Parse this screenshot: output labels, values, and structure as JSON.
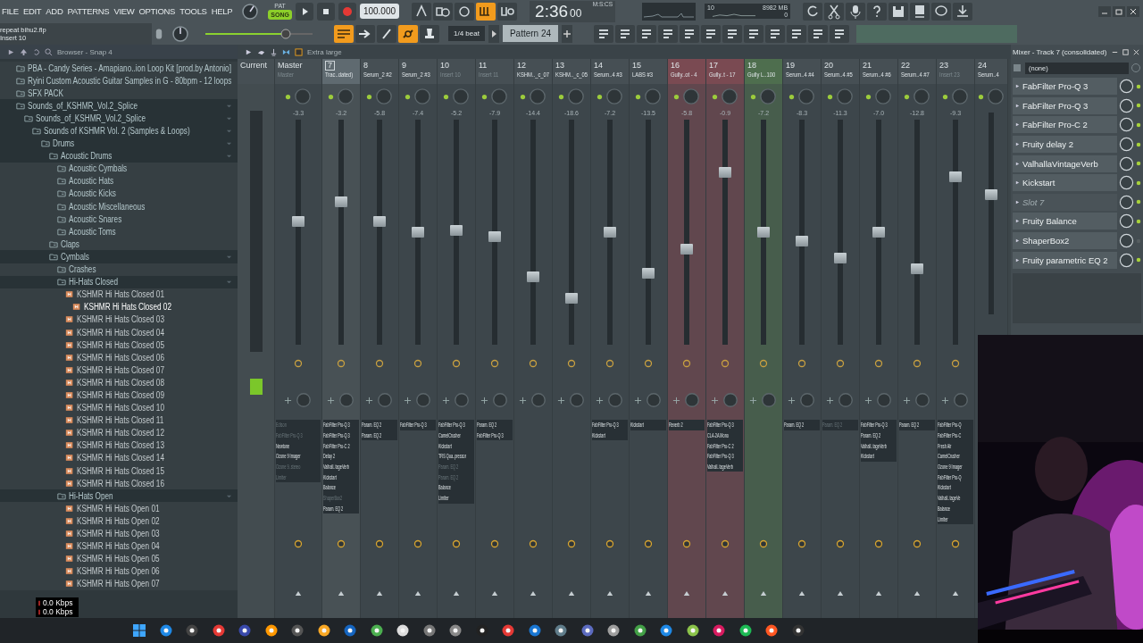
{
  "menu": [
    "FILE",
    "EDIT",
    "ADD",
    "PATTERNS",
    "VIEW",
    "OPTIONS",
    "TOOLS",
    "HELP"
  ],
  "transport": {
    "pat_label": "PAT",
    "mode_label": "SONG",
    "song_mode": true,
    "tempo": "100.000",
    "time": "2:36",
    "time_cs": "00",
    "time_unit": "M:S:CS",
    "cpu": "10",
    "memory": "8982 MB",
    "polyphony": "0"
  },
  "hint": {
    "file": "repeat bihu2.flp",
    "target": "Insert 10"
  },
  "snap": "1/4 beat",
  "pattern": "Pattern 24",
  "browser": {
    "title": "Browser - Snap 4",
    "tree": [
      {
        "kind": "folder",
        "name": "PBA - Candy Series - Amapiano..ion Loop Kit [prod.by Antonio]",
        "expanded": false,
        "selected": false
      },
      {
        "kind": "folder",
        "name": "Ryini Custom Acoustic Guitar Samples in G - 80bpm - 12 loops",
        "expanded": false,
        "selected": false
      },
      {
        "kind": "folder",
        "name": "SFX PACK",
        "expanded": false,
        "selected": false
      },
      {
        "kind": "folder",
        "name": "Sounds_of_KSHMR_Vol.2_Splice",
        "expanded": true,
        "selected": false,
        "children": [
          {
            "kind": "folder",
            "name": "Sounds_of_KSHMR_Vol.2_Splice",
            "expanded": true,
            "selected": false,
            "children": [
              {
                "kind": "folder",
                "name": "Sounds of KSHMR Vol. 2 (Samples & Loops)",
                "expanded": true,
                "selected": false,
                "children": [
                  {
                    "kind": "folder",
                    "name": "Drums",
                    "expanded": true,
                    "selected": false,
                    "children": [
                      {
                        "kind": "folder",
                        "name": "Acoustic Drums",
                        "expanded": true,
                        "selected": false,
                        "children": [
                          {
                            "kind": "folder",
                            "name": "Acoustic Cymbals",
                            "expanded": false,
                            "selected": false
                          },
                          {
                            "kind": "folder",
                            "name": "Acoustic Hats",
                            "expanded": false,
                            "selected": false
                          },
                          {
                            "kind": "folder",
                            "name": "Acoustic Kicks",
                            "expanded": false,
                            "selected": false
                          },
                          {
                            "kind": "folder",
                            "name": "Acoustic Miscellaneous",
                            "expanded": false,
                            "selected": false
                          },
                          {
                            "kind": "folder",
                            "name": "Acoustic Snares",
                            "expanded": false,
                            "selected": false
                          },
                          {
                            "kind": "folder",
                            "name": "Acoustic Toms",
                            "expanded": false,
                            "selected": false
                          }
                        ]
                      },
                      {
                        "kind": "folder",
                        "name": "Claps",
                        "expanded": false,
                        "selected": false
                      },
                      {
                        "kind": "folder",
                        "name": "Cymbals",
                        "expanded": true,
                        "selected": false,
                        "children": [
                          {
                            "kind": "folder",
                            "name": "Crashes",
                            "expanded": false,
                            "selected": false
                          },
                          {
                            "kind": "folder",
                            "name": "Hi-Hats Closed",
                            "expanded": true,
                            "selected": false,
                            "children": [
                              {
                                "kind": "file",
                                "name": "KSHMR Hi Hats Closed 01",
                                "selected": false
                              },
                              {
                                "kind": "file",
                                "name": "KSHMR Hi Hats Closed 02",
                                "selected": true
                              },
                              {
                                "kind": "file",
                                "name": "KSHMR Hi Hats Closed 03",
                                "selected": false
                              },
                              {
                                "kind": "file",
                                "name": "KSHMR Hi Hats Closed 04",
                                "selected": false
                              },
                              {
                                "kind": "file",
                                "name": "KSHMR Hi Hats Closed 05",
                                "selected": false
                              },
                              {
                                "kind": "file",
                                "name": "KSHMR Hi Hats Closed 06",
                                "selected": false
                              },
                              {
                                "kind": "file",
                                "name": "KSHMR Hi Hats Closed 07",
                                "selected": false
                              },
                              {
                                "kind": "file",
                                "name": "KSHMR Hi Hats Closed 08",
                                "selected": false
                              },
                              {
                                "kind": "file",
                                "name": "KSHMR Hi Hats Closed 09",
                                "selected": false
                              },
                              {
                                "kind": "file",
                                "name": "KSHMR Hi Hats Closed 10",
                                "selected": false
                              },
                              {
                                "kind": "file",
                                "name": "KSHMR Hi Hats Closed 11",
                                "selected": false
                              },
                              {
                                "kind": "file",
                                "name": "KSHMR Hi Hats Closed 12",
                                "selected": false
                              },
                              {
                                "kind": "file",
                                "name": "KSHMR Hi Hats Closed 13",
                                "selected": false
                              },
                              {
                                "kind": "file",
                                "name": "KSHMR Hi Hats Closed 14",
                                "selected": false
                              },
                              {
                                "kind": "file",
                                "name": "KSHMR Hi Hats Closed 15",
                                "selected": false
                              },
                              {
                                "kind": "file",
                                "name": "KSHMR Hi Hats Closed 16",
                                "selected": false
                              }
                            ]
                          },
                          {
                            "kind": "folder",
                            "name": "Hi-Hats Open",
                            "expanded": true,
                            "selected": false,
                            "children": [
                              {
                                "kind": "file",
                                "name": "KSHMR Hi Hats Open 01",
                                "selected": false
                              },
                              {
                                "kind": "file",
                                "name": "KSHMR Hi Hats Open 02",
                                "selected": false
                              },
                              {
                                "kind": "file",
                                "name": "KSHMR Hi Hats Open 03",
                                "selected": false
                              },
                              {
                                "kind": "file",
                                "name": "KSHMR Hi Hats Open 04",
                                "selected": false
                              },
                              {
                                "kind": "file",
                                "name": "KSHMR Hi Hats Open 05",
                                "selected": false
                              },
                              {
                                "kind": "file",
                                "name": "KSHMR Hi Hats Open 06",
                                "selected": false
                              },
                              {
                                "kind": "file",
                                "name": "KSHMR Hi Hats Open 07",
                                "selected": false
                              }
                            ]
                          }
                        ]
                      }
                    ]
                  }
                ]
              }
            ]
          }
        ]
      }
    ]
  },
  "mixer": {
    "view": "Extra large",
    "current_label": "Current",
    "tracks": [
      {
        "kind": "master",
        "number": "Master",
        "name": "Master",
        "default_name": true,
        "reading": "-3.3",
        "level": 0.55,
        "selected": false,
        "slots": [
          {
            "name": "Edison",
            "enabled": false
          },
          {
            "name": "FabFilter Pro-Q 3",
            "enabled": false
          },
          {
            "name": "Newtone",
            "enabled": true
          },
          {
            "name": "Ozone 9 Imager",
            "enabled": true
          },
          {
            "name": "Ozone 9..stereo",
            "enabled": false
          },
          {
            "name": "Limiter",
            "enabled": false
          }
        ]
      },
      {
        "kind": "insert",
        "number": "7",
        "name": "Trac..dated)",
        "default_name": false,
        "reading": "-3.2",
        "level": 0.64,
        "selected": true,
        "slots": [
          {
            "name": "FabFilter Pro-Q 3",
            "enabled": true
          },
          {
            "name": "FabFilter Pro-Q 3",
            "enabled": true
          },
          {
            "name": "FabFilter Pro-C 2",
            "enabled": true
          },
          {
            "name": "Delay 2",
            "enabled": true
          },
          {
            "name": "Valhall..tageVerb",
            "enabled": true
          },
          {
            "name": "Kickstart",
            "enabled": true
          },
          {
            "name": "Balance",
            "enabled": true
          },
          {
            "name": "ShaperBox2",
            "enabled": false
          },
          {
            "name": "Param. EQ 2",
            "enabled": true
          }
        ]
      },
      {
        "kind": "insert",
        "number": "8",
        "name": "Serum_2 #2",
        "default_name": false,
        "reading": "-5.8",
        "level": 0.55,
        "selected": false,
        "slots": [
          {
            "name": "Param. EQ 2",
            "enabled": true
          },
          {
            "name": "Param. EQ 2",
            "enabled": true
          }
        ]
      },
      {
        "kind": "insert",
        "number": "9",
        "name": "Serum_2 #3",
        "default_name": false,
        "reading": "-7.4",
        "level": 0.5,
        "selected": false,
        "slots": [
          {
            "name": "FabFilter Pro-Q 3",
            "enabled": true
          }
        ]
      },
      {
        "kind": "insert",
        "number": "10",
        "name": "Insert 10",
        "default_name": true,
        "reading": "-5.2",
        "level": 0.51,
        "selected": false,
        "slots": [
          {
            "name": "FabFilter Pro-Q 3",
            "enabled": true
          },
          {
            "name": "CamelCrusher",
            "enabled": true
          },
          {
            "name": "Kickstart",
            "enabled": true
          },
          {
            "name": "TRS Qua..pressor",
            "enabled": true
          },
          {
            "name": "Param. EQ 2",
            "enabled": false
          },
          {
            "name": "Param. EQ 2",
            "enabled": false
          },
          {
            "name": "Balance",
            "enabled": true
          },
          {
            "name": "Limiter",
            "enabled": true
          }
        ]
      },
      {
        "kind": "insert",
        "number": "11",
        "name": "Insert 11",
        "default_name": true,
        "reading": "-7.9",
        "level": 0.48,
        "selected": false,
        "slots": [
          {
            "name": "Param. EQ 2",
            "enabled": true
          },
          {
            "name": "FabFilter Pro-Q 3",
            "enabled": true
          }
        ]
      },
      {
        "kind": "insert",
        "number": "12",
        "name": "KSHM.._c_07",
        "default_name": false,
        "reading": "-14.4",
        "level": 0.29,
        "selected": false
      },
      {
        "kind": "insert",
        "number": "13",
        "name": "KSHM.._c_05",
        "default_name": false,
        "reading": "-18.6",
        "level": 0.19,
        "selected": false
      },
      {
        "kind": "insert",
        "number": "14",
        "name": "Serum..4 #3",
        "default_name": false,
        "reading": "-7.2",
        "level": 0.5,
        "selected": false,
        "slots": [
          {
            "name": "FabFilter Pro-Q 3",
            "enabled": true
          },
          {
            "name": "Kickstart",
            "enabled": true
          }
        ]
      },
      {
        "kind": "insert",
        "number": "15",
        "name": "LABS #3",
        "default_name": false,
        "reading": "-13.5",
        "level": 0.31,
        "selected": false,
        "slots": [
          {
            "name": "Kickstart",
            "enabled": true
          }
        ]
      },
      {
        "kind": "insert",
        "number": "16",
        "name": "Gully..ot - 4",
        "default_name": false,
        "reading": "-5.8",
        "level": 0.42,
        "selected": false,
        "color": "#7a4a52",
        "slots": [
          {
            "name": "Reverb 2",
            "enabled": true
          }
        ]
      },
      {
        "kind": "insert",
        "number": "17",
        "name": "Gully..t - 17",
        "default_name": false,
        "reading": "-0.9",
        "level": 0.78,
        "selected": false,
        "color": "#7a4a52",
        "slots": [
          {
            "name": "FabFilter Pro-Q 3",
            "enabled": true
          },
          {
            "name": "CLA-2A Mono",
            "enabled": true
          },
          {
            "name": "FabFilter Pro-C 2",
            "enabled": true
          },
          {
            "name": "FabFilter Pro-Q 3",
            "enabled": true
          },
          {
            "name": "Valhall..tageVerb",
            "enabled": true
          }
        ]
      },
      {
        "kind": "insert",
        "number": "18",
        "name": "Gully L..100",
        "default_name": false,
        "reading": "-7.2",
        "level": 0.5,
        "selected": false,
        "color": "#4e6e4e"
      },
      {
        "kind": "insert",
        "number": "19",
        "name": "Serum..4 #4",
        "default_name": false,
        "reading": "-8.3",
        "level": 0.46,
        "selected": false,
        "slots": [
          {
            "name": "Param. EQ 2",
            "enabled": true
          }
        ]
      },
      {
        "kind": "insert",
        "number": "20",
        "name": "Serum..4 #5",
        "default_name": false,
        "reading": "-11.3",
        "level": 0.38,
        "selected": false,
        "slots": [
          {
            "name": "Param. EQ 2",
            "enabled": false
          }
        ]
      },
      {
        "kind": "insert",
        "number": "21",
        "name": "Serum..4 #6",
        "default_name": false,
        "reading": "-7.0",
        "level": 0.5,
        "selected": false,
        "slots": [
          {
            "name": "FabFilter Pro-Q 3",
            "enabled": true
          },
          {
            "name": "Param. EQ 2",
            "enabled": true
          },
          {
            "name": "Valhall..tageVerb",
            "enabled": true
          },
          {
            "name": "Kickstart",
            "enabled": true
          }
        ]
      },
      {
        "kind": "insert",
        "number": "22",
        "name": "Serum..4 #7",
        "default_name": false,
        "reading": "-12.8",
        "level": 0.33,
        "selected": false,
        "slots": [
          {
            "name": "Param. EQ 2",
            "enabled": true
          }
        ]
      },
      {
        "kind": "insert",
        "number": "23",
        "name": "Insert 23",
        "default_name": true,
        "reading": "-9.3",
        "level": 0.76,
        "selected": false,
        "slots": [
          {
            "name": "FabFilter Pro-Q",
            "enabled": true
          },
          {
            "name": "FabFilter Pro-C",
            "enabled": true
          },
          {
            "name": "Fresh Air",
            "enabled": true
          },
          {
            "name": "CamelCrusher",
            "enabled": true
          },
          {
            "name": "Ozone 9 Imager",
            "enabled": true
          },
          {
            "name": "FabFilter Pro-Q",
            "enabled": true
          },
          {
            "name": "Kickstart",
            "enabled": true
          },
          {
            "name": "Valhall..tageVe",
            "enabled": true
          },
          {
            "name": "Balance",
            "enabled": true
          },
          {
            "name": "Limiter",
            "enabled": true
          }
        ]
      },
      {
        "kind": "insert",
        "number": "24",
        "name": "Serum..4",
        "default_name": false,
        "level": 0.6,
        "selected": false
      }
    ]
  },
  "fx_panel": {
    "title": "Mixer - Track 7 (consolidated)",
    "input": "(none)",
    "slots": [
      {
        "name": "FabFilter Pro-Q 3",
        "empty": false,
        "on": true
      },
      {
        "name": "FabFilter Pro-Q 3",
        "empty": false,
        "on": true
      },
      {
        "name": "FabFilter Pro-C 2",
        "empty": false,
        "on": true
      },
      {
        "name": "Fruity delay 2",
        "empty": false,
        "on": true
      },
      {
        "name": "ValhallaVintageVerb",
        "empty": false,
        "on": true
      },
      {
        "name": "Kickstart",
        "empty": false,
        "on": true
      },
      {
        "name": "Slot 7",
        "empty": true,
        "on": true
      },
      {
        "name": "Fruity Balance",
        "empty": false,
        "on": true
      },
      {
        "name": "ShaperBox2",
        "empty": false,
        "on": false
      },
      {
        "name": "Fruity parametric EQ 2",
        "empty": false,
        "on": true
      }
    ]
  },
  "network": [
    "0.0 Kbps",
    "0.0 Kbps"
  ]
}
